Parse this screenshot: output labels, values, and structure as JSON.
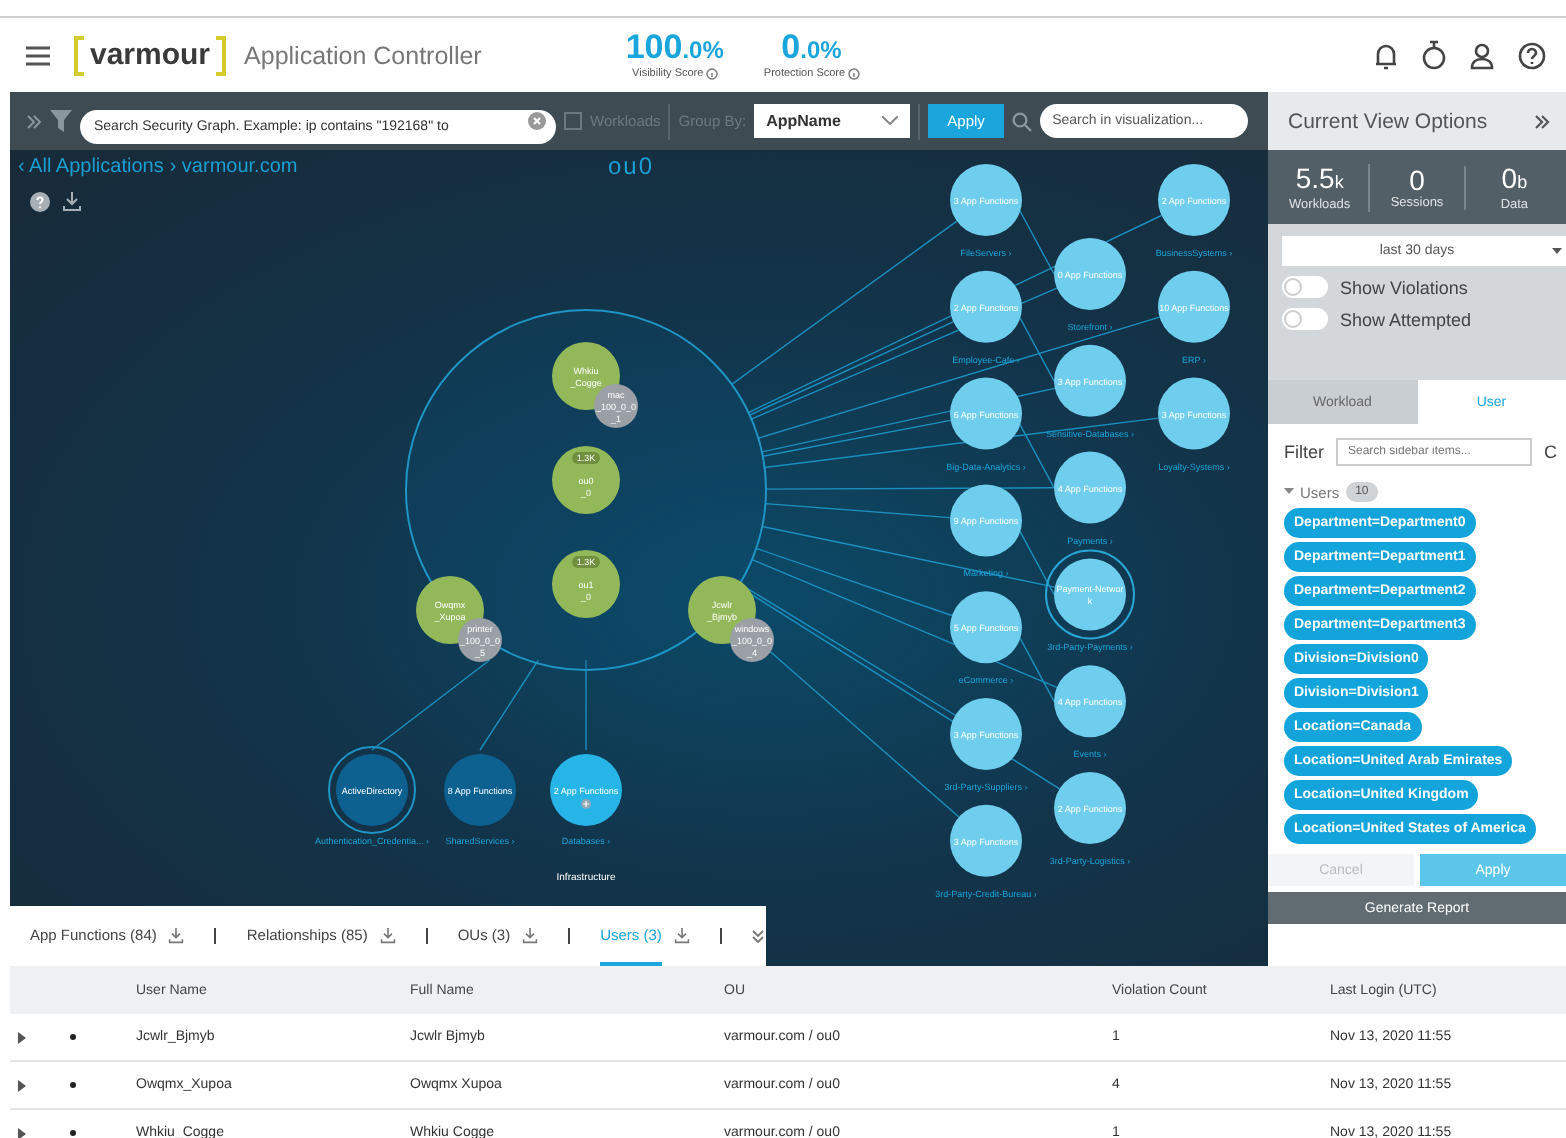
{
  "header": {
    "logo": "varmour",
    "title": "Application Controller",
    "scores": [
      {
        "value": "100",
        "fraction": ".0%",
        "label": "Visibility Score"
      },
      {
        "value": "0",
        "fraction": ".0%",
        "label": "Protection Score"
      }
    ]
  },
  "toolbar": {
    "search_placeholder": "Search Security Graph. Example: ip contains \"192168\" to",
    "workloads": {
      "label": "Workloads",
      "checked": false
    },
    "group_by_label": "Group By:",
    "group_by_value": "AppName",
    "apply": "Apply",
    "viz_search_placeholder": "Search in visualization..."
  },
  "graph": {
    "breadcrumb": [
      "‹ All Applications",
      "› varmour.com"
    ],
    "title": "ou0",
    "ou_cluster": [
      {
        "lines": [
          "Whkiu",
          "_Cogge"
        ],
        "badge": [
          "mac",
          "_100_0_0",
          "_1"
        ]
      },
      {
        "lines": [
          "ou0",
          "_0"
        ],
        "count": "1.3K"
      },
      {
        "lines": [
          "ou1",
          "_0"
        ],
        "count": "1.3K"
      },
      {
        "lines": [
          "Owqmx",
          "_Xupoa"
        ],
        "badge": [
          "printer",
          "_100_0_0",
          "_5"
        ]
      },
      {
        "lines": [
          "Jcwlr",
          "_Bjmyb"
        ],
        "badge": [
          "windows",
          "_100_0_0",
          "_4"
        ]
      }
    ],
    "infrastructure": {
      "title": "Infrastructure",
      "nodes": [
        {
          "lines": [
            "ActiveDirectory"
          ],
          "caption": "Authentication_Credentia... ›",
          "kind": "ringed_dark",
          "expandable": false
        },
        {
          "lines": [
            "8 App Functions"
          ],
          "caption": "SharedServices ›",
          "kind": "dark",
          "expandable": false
        },
        {
          "lines": [
            "2 App Functions"
          ],
          "caption": "Databases ›",
          "kind": "bright",
          "expandable": true
        }
      ]
    },
    "app_groups": [
      [
        {
          "lines": [
            "3 App Functions"
          ],
          "caption": "FileServers ›",
          "kind": "plain"
        },
        {
          "lines": [
            "2 App Functions"
          ],
          "caption": "Employee-Cafe ›",
          "kind": "plain"
        },
        {
          "lines": [
            "6 App Functions"
          ],
          "caption": "Big-Data-Analytics ›",
          "kind": "plain"
        },
        {
          "lines": [
            "9 App Functions"
          ],
          "caption": "Marketing ›",
          "kind": "plain"
        },
        {
          "lines": [
            "5 App Functions"
          ],
          "caption": "eCommerce ›",
          "kind": "plain"
        },
        {
          "lines": [
            "3 App Functions"
          ],
          "caption": "3rd-Party-Suppliers ›",
          "kind": "plain"
        },
        {
          "lines": [
            "3 App Functions"
          ],
          "caption": "3rd-Party-Credit-Bureau ›",
          "kind": "plain"
        }
      ],
      [
        {
          "lines": [
            "0 App Functions"
          ],
          "caption": "Storefront ›",
          "kind": "plain"
        },
        {
          "lines": [
            "3 App Functions"
          ],
          "caption": "Sensitive-Databases ›",
          "kind": "plain"
        },
        {
          "lines": [
            "4 App Functions"
          ],
          "caption": "Payments ›",
          "kind": "plain"
        },
        {
          "lines": [
            "Payment-Networ",
            "k"
          ],
          "caption": "3rd-Party-Payments ›",
          "kind": "ringed"
        },
        {
          "lines": [
            "4 App Functions"
          ],
          "caption": "Events ›",
          "kind": "plain"
        },
        {
          "lines": [
            "2 App Functions"
          ],
          "caption": "3rd-Party-Logistics ›",
          "kind": "plain"
        }
      ],
      [
        {
          "lines": [
            "2 App Functions"
          ],
          "caption": "BusinessSystems ›",
          "kind": "plain"
        },
        {
          "lines": [
            "10 App Functions"
          ],
          "caption": "ERP ›",
          "kind": "plain"
        },
        {
          "lines": [
            "3 App Functions"
          ],
          "caption": "Loyalty-Systems ›",
          "kind": "plain"
        }
      ]
    ]
  },
  "bottom_tabs": [
    {
      "label": "App Functions (84)",
      "selected": false
    },
    {
      "label": "Relationships (85)",
      "selected": false
    },
    {
      "label": "OUs (3)",
      "selected": false
    },
    {
      "label": "Users (3)",
      "selected": true
    }
  ],
  "table": {
    "columns": [
      "User Name",
      "Full Name",
      "OU",
      "Violation Count",
      "Last Login (UTC)"
    ],
    "rows": [
      [
        "Jcwlr_Bjmyb",
        "Jcwlr Bjmyb",
        "varmour.com / ou0",
        "1",
        "Nov 13, 2020 11:55"
      ],
      [
        "Owqmx_Xupoa",
        "Owqmx Xupoa",
        "varmour.com / ou0",
        "4",
        "Nov 13, 2020 11:55"
      ],
      [
        "Whkiu_Cogge",
        "Whkiu Cogge",
        "varmour.com / ou0",
        "1",
        "Nov 13, 2020 11:55"
      ]
    ]
  },
  "sidebar": {
    "title": "Current View Options",
    "stats": [
      {
        "value": "5.5",
        "unit": "k",
        "label": "Workloads"
      },
      {
        "value": "0",
        "label": "Sessions"
      },
      {
        "value": "0",
        "unit": "b",
        "label": "Data"
      }
    ],
    "date_range": "last 30 days",
    "toggles": [
      {
        "label": "Show Violations",
        "on": false
      },
      {
        "label": "Show Attempted",
        "on": false
      }
    ],
    "tabs": [
      {
        "label": "Workload",
        "selected": false
      },
      {
        "label": "User",
        "selected": true
      }
    ],
    "filter_label": "Filter",
    "filter_placeholder": "Search sidebar items...",
    "filter_extra": "C",
    "group": {
      "label": "Users",
      "count": "10",
      "expanded": true
    },
    "tags": [
      "Department=Department0",
      "Department=Department1",
      "Department=Department2",
      "Department=Department3",
      "Division=Division0",
      "Division=Division1",
      "Location=Canada",
      "Location=United Arab Emirates",
      "Location=United Kingdom",
      "Location=United States of America"
    ],
    "cancel": {
      "label": "Cancel",
      "disabled": true
    },
    "apply": "Apply",
    "report": "Generate Report"
  }
}
